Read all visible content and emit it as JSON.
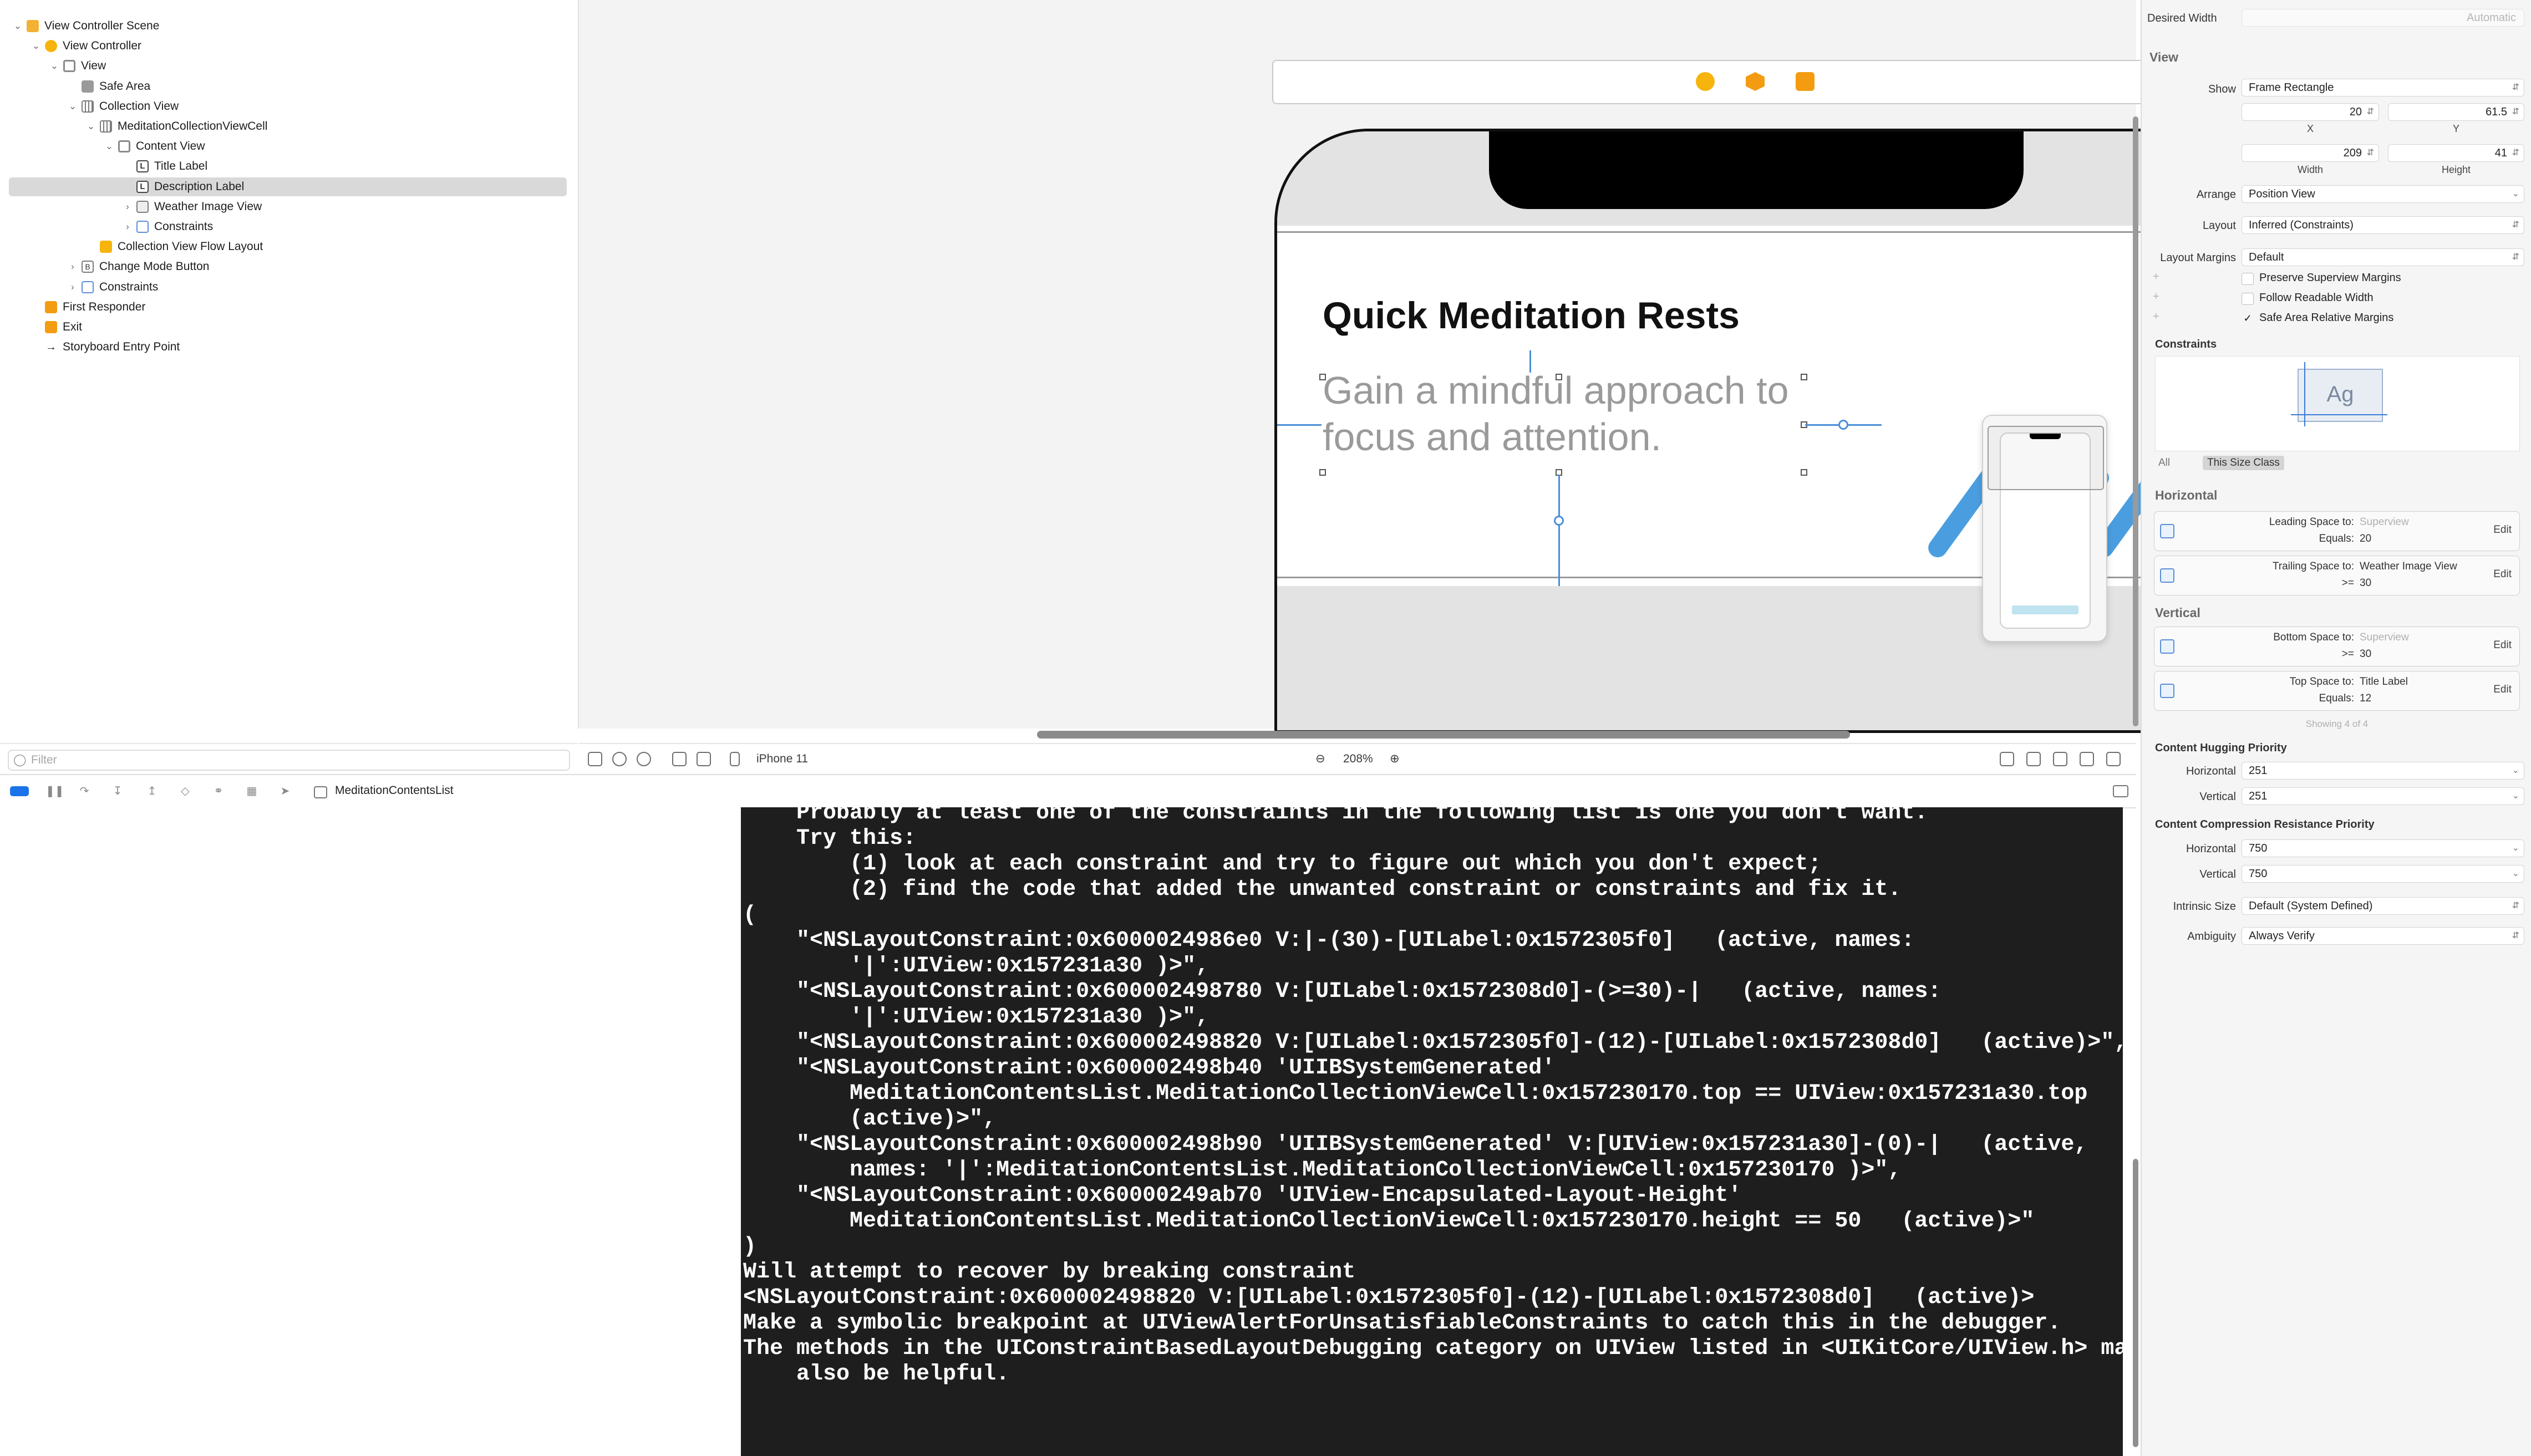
{
  "outline": {
    "items": [
      {
        "label": "View Controller Scene",
        "depth": 0,
        "open": "v",
        "icon": "scene-icon"
      },
      {
        "label": "View Controller",
        "depth": 1,
        "open": "v",
        "icon": "view-controller-icon"
      },
      {
        "label": "View",
        "depth": 2,
        "open": "v",
        "icon": "view-icon"
      },
      {
        "label": "Safe Area",
        "depth": 3,
        "open": "",
        "icon": "safe-area-icon"
      },
      {
        "label": "Collection View",
        "depth": 3,
        "open": "v",
        "icon": "collection-view-icon"
      },
      {
        "label": "MeditationCollectionViewCell",
        "depth": 4,
        "open": "v",
        "icon": "collection-view-cell-icon"
      },
      {
        "label": "Content View",
        "depth": 5,
        "open": "v",
        "icon": "view-icon"
      },
      {
        "label": "Title Label",
        "depth": 6,
        "open": "",
        "icon": "label-icon"
      },
      {
        "label": "Description Label",
        "depth": 6,
        "open": "",
        "icon": "label-icon",
        "selected": true
      },
      {
        "label": "Weather Image View",
        "depth": 6,
        "open": ">",
        "icon": "image-view-icon"
      },
      {
        "label": "Constraints",
        "depth": 6,
        "open": ">",
        "icon": "constraints-icon"
      },
      {
        "label": "Collection View Flow Layout",
        "depth": 4,
        "open": "",
        "icon": "flow-layout-icon"
      },
      {
        "label": "Change Mode Button",
        "depth": 3,
        "open": ">",
        "icon": "button-icon"
      },
      {
        "label": "Constraints",
        "depth": 3,
        "open": ">",
        "icon": "constraints-icon"
      },
      {
        "label": "First Responder",
        "depth": 1,
        "open": "",
        "icon": "first-responder-icon"
      },
      {
        "label": "Exit",
        "depth": 1,
        "open": "",
        "icon": "exit-icon"
      },
      {
        "label": "Storyboard Entry Point",
        "depth": 1,
        "open": "",
        "icon": "entry-point-icon"
      }
    ],
    "filter_placeholder": "Filter"
  },
  "canvas": {
    "cell_title": "Quick Meditation Rests",
    "cell_description": "Gain a mindful approach to focus and attention.",
    "device": "iPhone 11",
    "zoom": "208%"
  },
  "debug_bar": {
    "target": "MeditationContentsList"
  },
  "console": {
    "lines": [
      "    Probably at least one of the constraints in the following list is one you don't want.",
      "    Try this:",
      "        (1) look at each constraint and try to figure out which you don't expect;",
      "        (2) find the code that added the unwanted constraint or constraints and fix it.",
      "(",
      "    \"<NSLayoutConstraint:0x6000024986e0 V:|-(30)-[UILabel:0x1572305f0]   (active, names:",
      "        '|':UIView:0x157231a30 )>\",",
      "    \"<NSLayoutConstraint:0x600002498780 V:[UILabel:0x1572308d0]-(>=30)-|   (active, names:",
      "        '|':UIView:0x157231a30 )>\",",
      "    \"<NSLayoutConstraint:0x600002498820 V:[UILabel:0x1572305f0]-(12)-[UILabel:0x1572308d0]   (active)>\",",
      "    \"<NSLayoutConstraint:0x600002498b40 'UIIBSystemGenerated'",
      "        MeditationContentsList.MeditationCollectionViewCell:0x157230170.top == UIView:0x157231a30.top",
      "        (active)>\",",
      "    \"<NSLayoutConstraint:0x600002498b90 'UIIBSystemGenerated' V:[UIView:0x157231a30]-(0)-|   (active,",
      "        names: '|':MeditationContentsList.MeditationCollectionViewCell:0x157230170 )>\",",
      "    \"<NSLayoutConstraint:0x60000249ab70 'UIView-Encapsulated-Layout-Height'",
      "        MeditationContentsList.MeditationCollectionViewCell:0x157230170.height == 50   (active)>\"",
      ")",
      "",
      "Will attempt to recover by breaking constraint",
      "<NSLayoutConstraint:0x600002498820 V:[UILabel:0x1572305f0]-(12)-[UILabel:0x1572308d0]   (active)>",
      "",
      "Make a symbolic breakpoint at UIViewAlertForUnsatisfiableConstraints to catch this in the debugger.",
      "The methods in the UIConstraintBasedLayoutDebugging category on UIView listed in <UIKitCore/UIView.h> may",
      "    also be helpful."
    ]
  },
  "inspector": {
    "desired_width_label": "Desired Width",
    "desired_width_placeholder": "Automatic",
    "view_section": "View",
    "show_label": "Show",
    "show_value": "Frame Rectangle",
    "x_value": "20",
    "y_value": "61.5",
    "x_label": "X",
    "y_label": "Y",
    "width_value": "209",
    "height_value": "41",
    "width_label": "Width",
    "height_label": "Height",
    "arrange_label": "Arrange",
    "arrange_value": "Position View",
    "layout_label": "Layout",
    "layout_value": "Inferred (Constraints)",
    "layout_margins_label": "Layout Margins",
    "layout_margins_value": "Default",
    "check_preserve": "Preserve Superview Margins",
    "check_readable": "Follow Readable Width",
    "check_safe_area": "Safe Area Relative Margins",
    "constraints_section": "Constraints",
    "ag_text": "Ag",
    "tab_all": "All",
    "tab_size_class": "This Size Class",
    "horizontal_section": "Horizontal",
    "vertical_section": "Vertical",
    "constraints": [
      {
        "r1": "Leading Space to:",
        "v1": "Superview",
        "v1_dim": true,
        "r2": "Equals:",
        "v2": "20",
        "edit": "Edit"
      },
      {
        "r1": "Trailing Space to:",
        "v1": "Weather Image View",
        "v1_dim": false,
        "r2": ">=",
        "v2": "30",
        "edit": "Edit"
      },
      {
        "r1": "Bottom Space to:",
        "v1": "Superview",
        "v1_dim": true,
        "r2": ">=",
        "v2": "30",
        "edit": "Edit"
      },
      {
        "r1": "Top Space to:",
        "v1": "Title Label",
        "v1_dim": false,
        "r2": "Equals:",
        "v2": "12",
        "edit": "Edit"
      }
    ],
    "showing": "Showing 4 of 4",
    "hugging_section": "Content Hugging Priority",
    "hugging_h_label": "Horizontal",
    "hugging_h": "251",
    "hugging_v_label": "Vertical",
    "hugging_v": "251",
    "compression_section": "Content Compression Resistance Priority",
    "compression_h_label": "Horizontal",
    "compression_h": "750",
    "compression_v_label": "Vertical",
    "compression_v": "750",
    "intrinsic_label": "Intrinsic Size",
    "intrinsic_value": "Default (System Defined)",
    "ambiguity_label": "Ambiguity",
    "ambiguity_value": "Always Verify"
  }
}
